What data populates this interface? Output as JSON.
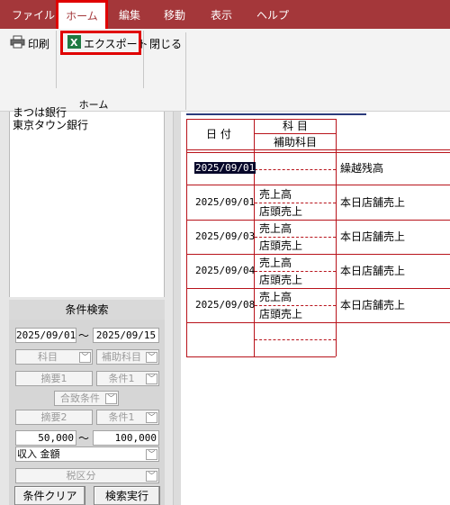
{
  "menubar": {
    "items": [
      "ファイル",
      "ホーム",
      "編集",
      "移動",
      "表示",
      "ヘルプ"
    ],
    "active": "ホーム"
  },
  "ribbon": {
    "print_label": "印刷",
    "export_label": "エクスポート",
    "close_label": "閉じる",
    "group_label": "ホーム",
    "export_icon_letter": "X"
  },
  "bank_list": {
    "partial_item": "まつは銀行",
    "items": [
      "東京タウン銀行"
    ]
  },
  "search": {
    "title": "条件検索",
    "date_from": "2025/09/01",
    "date_to": "2025/09/15",
    "range_separator": "〜",
    "subject_placeholder": "科目",
    "subsidiary_placeholder": "補助科目",
    "summary1_placeholder": "摘要1",
    "condition1_placeholder": "条件1",
    "match_condition_placeholder": "合致条件",
    "summary2_placeholder": "摘要2",
    "condition2_placeholder": "条件1",
    "amount_from": "50,000",
    "amount_to": "100,000",
    "amount_type": "収入 金額",
    "tax_placeholder": "税区分",
    "clear_button": "条件クリア",
    "search_button": "検索実行"
  },
  "ledger": {
    "header_date": "日 付",
    "header_subject": "科 目",
    "header_subsidiary": "補助科目",
    "rows": [
      {
        "date": "2025/09/01",
        "subject": "",
        "subsidiary": "",
        "summary": "繰越残高"
      },
      {
        "date": "2025/09/01",
        "subject": "売上高",
        "subsidiary": "店頭売上",
        "summary": "本日店舗売上"
      },
      {
        "date": "2025/09/03",
        "subject": "売上高",
        "subsidiary": "店頭売上",
        "summary": "本日店舗売上"
      },
      {
        "date": "2025/09/04",
        "subject": "売上高",
        "subsidiary": "店頭売上",
        "summary": "本日店舗売上"
      },
      {
        "date": "2025/09/08",
        "subject": "売上高",
        "subsidiary": "店頭売上",
        "summary": "本日店舗売上"
      }
    ]
  },
  "colors": {
    "menubar_bg": "#a4373a",
    "highlight_border": "#e00000",
    "ledger_lines": "#b8131b",
    "selection_bg": "#06072a"
  }
}
